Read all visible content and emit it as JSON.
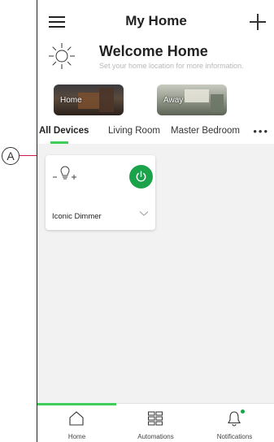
{
  "header": {
    "title": "My Home",
    "welcome_title": "Welcome Home",
    "welcome_subtitle": "Set your home location for more information."
  },
  "scenes": [
    {
      "label": "Home"
    },
    {
      "label": "Away"
    }
  ],
  "tabs": [
    {
      "label": "All Devices",
      "active": true
    },
    {
      "label": "Living Room",
      "active": false
    },
    {
      "label": "Master Bedroom",
      "active": false
    }
  ],
  "device": {
    "name": "Iconic Dimmer",
    "power_on": true
  },
  "bottom_nav": [
    {
      "label": "Home",
      "icon": "home-icon",
      "active": true
    },
    {
      "label": "Automations",
      "icon": "grid-icon",
      "active": false
    },
    {
      "label": "Notifications",
      "icon": "bell-icon",
      "active": false
    }
  ],
  "callout": {
    "letter": "A"
  },
  "colors": {
    "accent_green": "#3dcd58",
    "power_green": "#1aa34a",
    "callout_line": "#c8194b"
  }
}
